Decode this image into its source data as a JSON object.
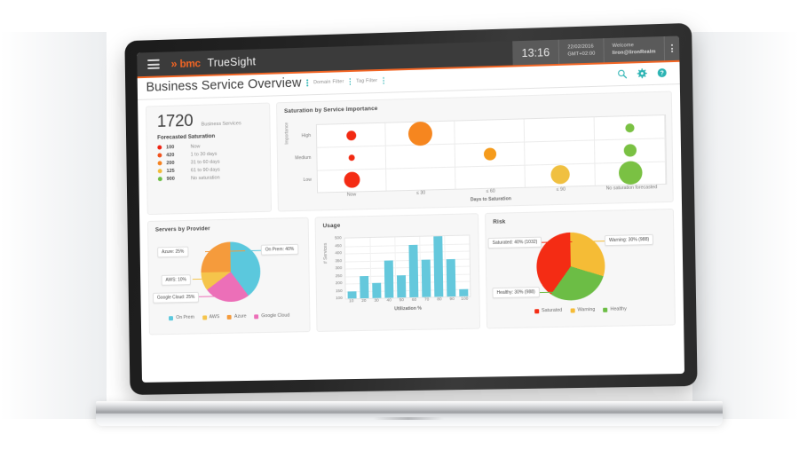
{
  "appbar": {
    "menu_icon": "hamburger-menu-icon",
    "brand_chevron": "»",
    "brand": "bmc",
    "product": "TrueSight",
    "time": "13:16",
    "date": "22/02/2016",
    "timezone": "GMT+02:00",
    "welcome_label": "Welcome",
    "user": "liron@lironRealm"
  },
  "pagebar": {
    "title": "Business Service Overview",
    "domain_filter": "Domain Filter",
    "tag_filter": "Tag Filter",
    "search_icon": "search-icon",
    "settings_icon": "gear-icon",
    "help_icon": "help-icon"
  },
  "summary": {
    "count": "1720",
    "count_label": "Business Services",
    "forecast_title": "Forecasted Saturation",
    "rows": [
      {
        "value": "100",
        "label": "Now",
        "color": "#ee2211"
      },
      {
        "value": "420",
        "label": "1 to 30 days",
        "color": "#f1521c"
      },
      {
        "value": "200",
        "label": "31 to 60 days",
        "color": "#f58220"
      },
      {
        "value": "125",
        "label": "61 to 90 days",
        "color": "#f2bb3a"
      },
      {
        "value": "900",
        "label": "No saturation",
        "color": "#6cbd45"
      }
    ]
  },
  "chart_data": [
    {
      "type": "scatter",
      "name": "saturation-by-service-importance",
      "title": "Saturation by Service Importance",
      "xlabel": "Days to Saturation",
      "ylabel": "Importance",
      "categories": [
        "Now",
        "≤ 30",
        "≤ 60",
        "≤ 90",
        "No saturation forecasted"
      ],
      "y_categories": [
        "High",
        "Medium",
        "Low"
      ],
      "grid": true,
      "points": [
        {
          "x": "Now",
          "y": "High",
          "size": 11,
          "color": "#f22a12"
        },
        {
          "x": "Now",
          "y": "Medium",
          "size": 7,
          "color": "#f22a12"
        },
        {
          "x": "Now",
          "y": "Low",
          "size": 18,
          "color": "#f42c14"
        },
        {
          "x": "≤ 30",
          "y": "High",
          "size": 27,
          "color": "#f6861f"
        },
        {
          "x": "≤ 60",
          "y": "Medium",
          "size": 14,
          "color": "#f59b1c"
        },
        {
          "x": "≤ 90",
          "y": "Low",
          "size": 21,
          "color": "#f0c041"
        },
        {
          "x": "No saturation forecasted",
          "y": "High",
          "size": 10,
          "color": "#7ac143"
        },
        {
          "x": "No saturation forecasted",
          "y": "Medium",
          "size": 14,
          "color": "#7ac143"
        },
        {
          "x": "No saturation forecasted",
          "y": "Low",
          "size": 26,
          "color": "#7ac143"
        }
      ]
    },
    {
      "type": "pie",
      "name": "servers-by-provider",
      "title": "Servers by Provider",
      "legend_position": "bottom",
      "slices": [
        {
          "label": "On Prem",
          "value": 40,
          "callout": "On Prem: 40%",
          "color": "#5bc8dd"
        },
        {
          "label": "Google Cloud",
          "value": 25,
          "callout": "Google Cloud: 25%",
          "color": "#ec6fb8"
        },
        {
          "label": "AWS",
          "value": 10,
          "callout": "AWS: 10%",
          "color": "#f5c44b"
        },
        {
          "label": "Azure",
          "value": 25,
          "callout": "Azure: 25%",
          "color": "#f7a council"
        }
      ]
    },
    {
      "type": "bar",
      "name": "usage",
      "title": "Usage",
      "xlabel": "Utilization %",
      "ylabel": "# Services",
      "categories": [
        "10",
        "20",
        "30",
        "40",
        "50",
        "60",
        "70",
        "80",
        "90",
        "100"
      ],
      "values": [
        150,
        250,
        200,
        350,
        250,
        450,
        350,
        500,
        350,
        150
      ],
      "ylim": [
        100,
        500
      ],
      "yticks": [
        "500",
        "450",
        "400",
        "350",
        "300",
        "250",
        "200",
        "150",
        "100"
      ],
      "bar_color": "#64c8dc",
      "grid": true
    },
    {
      "type": "pie",
      "name": "risk",
      "title": "Risk",
      "legend_position": "bottom",
      "slices": [
        {
          "label": "Saturated",
          "value": 40,
          "count": 1032,
          "callout": "Saturated: 40% (1032)",
          "color": "#f42c14"
        },
        {
          "label": "Warning",
          "value": 30,
          "count": 988,
          "callout": "Warning: 30% (988)",
          "color": "#f5bc36"
        },
        {
          "label": "Healthy",
          "value": 30,
          "count": 988,
          "callout": "Healthy: 30% (988)",
          "color": "#6cbd45"
        }
      ]
    }
  ],
  "provider_legend": [
    {
      "label": "On Prem",
      "color": "#5bc8dd"
    },
    {
      "label": "AWS",
      "color": "#f5c44b"
    },
    {
      "label": "Azure",
      "color": "#f59b3c"
    },
    {
      "label": "Google Cloud",
      "color": "#ec6fb8"
    }
  ],
  "risk_legend": [
    {
      "label": "Saturated",
      "color": "#f42c14"
    },
    {
      "label": "Warning",
      "color": "#f5bc36"
    },
    {
      "label": "Healthy",
      "color": "#6cbd45"
    }
  ]
}
